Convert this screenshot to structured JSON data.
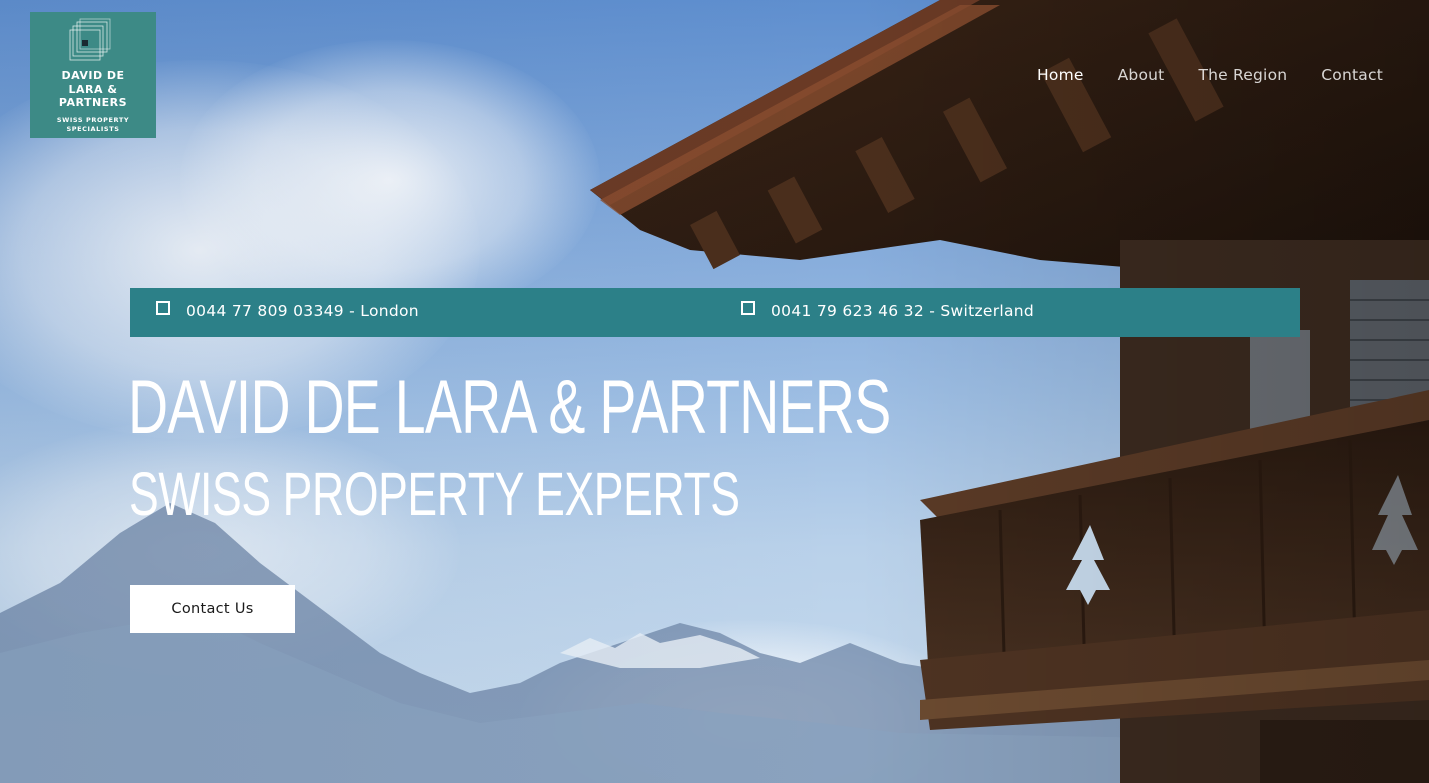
{
  "logo": {
    "title": "DAVID DE\nLARA &\nPARTNERS",
    "subtitle": "SWISS PROPERTY\nSPECIALISTS"
  },
  "nav": {
    "items": [
      {
        "label": "Home",
        "active": true
      },
      {
        "label": "About",
        "active": false
      },
      {
        "label": "The Region",
        "active": false
      },
      {
        "label": "Contact",
        "active": false
      }
    ]
  },
  "contact_bar": {
    "phones": [
      {
        "icon": "square-icon",
        "text": "0044 77 809 03349 - London"
      },
      {
        "icon": "square-icon",
        "text": "0041 79 623 46 32 - Switzerland"
      }
    ]
  },
  "hero": {
    "title": "DAVID DE LARA & PARTNERS",
    "subtitle": "SWISS PROPERTY EXPERTS",
    "cta_label": "Contact Us"
  },
  "colors": {
    "brand_teal": "#2c8088",
    "logo_teal": "#3d8a86",
    "cta_bg": "#ffffff"
  }
}
